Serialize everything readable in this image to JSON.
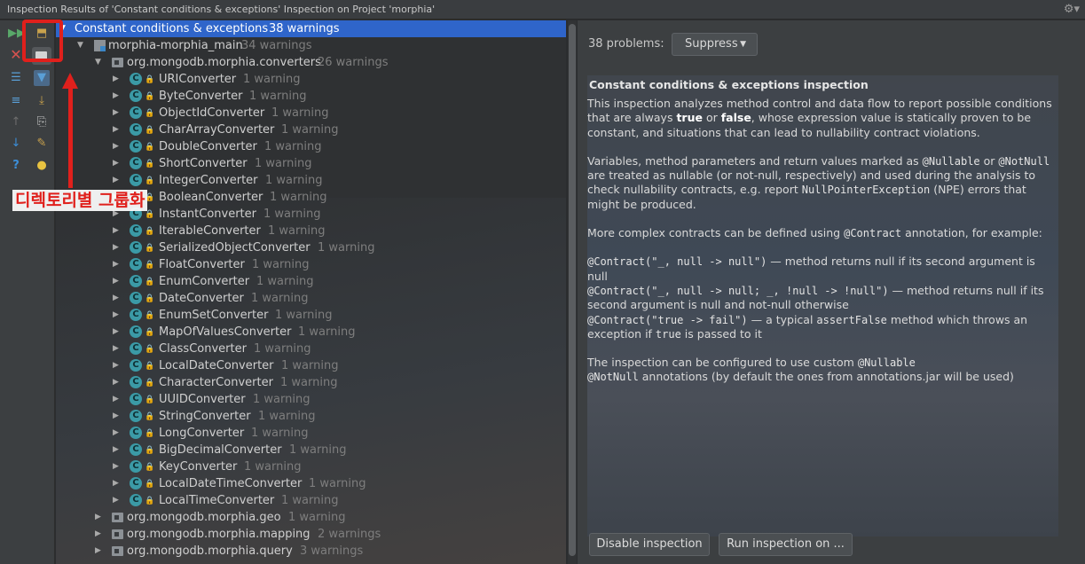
{
  "window": {
    "title": "Inspection Results of 'Constant conditions & exceptions' Inspection on Project 'morphia'"
  },
  "toolbar": {
    "icons": [
      "rerun-icon",
      "export-icon",
      "close-icon",
      "group-by-directory-icon",
      "expand-all-icon",
      "filter-icon",
      "collapse-all-icon",
      "import-icon",
      "previous-icon",
      "apply-fix-icon",
      "next-icon",
      "settings-icon",
      "help-icon",
      "lightbulb-icon"
    ],
    "accent": "#e0201c"
  },
  "annotation": {
    "label": "디렉토리별 그룹화"
  },
  "tree": {
    "root": {
      "name": "Constant conditions & exceptions",
      "count": "38 warnings"
    },
    "module": {
      "name": "morphia-morphia_main",
      "count": "34 warnings"
    },
    "package": {
      "name": "org.mongodb.morphia.converters",
      "count": "26 warnings"
    },
    "classes": [
      {
        "name": "URIConverter",
        "count": "1 warning"
      },
      {
        "name": "ByteConverter",
        "count": "1 warning"
      },
      {
        "name": "ObjectIdConverter",
        "count": "1 warning"
      },
      {
        "name": "CharArrayConverter",
        "count": "1 warning"
      },
      {
        "name": "DoubleConverter",
        "count": "1 warning"
      },
      {
        "name": "ShortConverter",
        "count": "1 warning"
      },
      {
        "name": "IntegerConverter",
        "count": "1 warning"
      },
      {
        "name": "BooleanConverter",
        "count": "1 warning"
      },
      {
        "name": "InstantConverter",
        "count": "1 warning"
      },
      {
        "name": "IterableConverter",
        "count": "1 warning"
      },
      {
        "name": "SerializedObjectConverter",
        "count": "1 warning"
      },
      {
        "name": "FloatConverter",
        "count": "1 warning"
      },
      {
        "name": "EnumConverter",
        "count": "1 warning"
      },
      {
        "name": "DateConverter",
        "count": "1 warning"
      },
      {
        "name": "EnumSetConverter",
        "count": "1 warning"
      },
      {
        "name": "MapOfValuesConverter",
        "count": "1 warning"
      },
      {
        "name": "ClassConverter",
        "count": "1 warning"
      },
      {
        "name": "LocalDateConverter",
        "count": "1 warning"
      },
      {
        "name": "CharacterConverter",
        "count": "1 warning"
      },
      {
        "name": "UUIDConverter",
        "count": "1 warning"
      },
      {
        "name": "StringConverter",
        "count": "1 warning"
      },
      {
        "name": "LongConverter",
        "count": "1 warning"
      },
      {
        "name": "BigDecimalConverter",
        "count": "1 warning"
      },
      {
        "name": "KeyConverter",
        "count": "1 warning"
      },
      {
        "name": "LocalDateTimeConverter",
        "count": "1 warning"
      },
      {
        "name": "LocalTimeConverter",
        "count": "1 warning"
      }
    ],
    "packages": [
      {
        "name": "org.mongodb.morphia.geo",
        "count": "1 warning"
      },
      {
        "name": "org.mongodb.morphia.mapping",
        "count": "2 warnings"
      },
      {
        "name": "org.mongodb.morphia.query",
        "count": "3 warnings"
      }
    ]
  },
  "details": {
    "problems_label": "38 problems:",
    "suppress_label": "Suppress",
    "title": "Constant conditions & exceptions inspection",
    "p1": {
      "a": "This inspection analyzes method control and data flow to report possible conditions that are always ",
      "b": "true",
      "c": " or ",
      "d": "false",
      "e": ", whose expression value is statically proven to be constant, and situations that can lead to nullability contract violations."
    },
    "p2": {
      "a": "Variables, method parameters and return values marked as ",
      "b": "@Nullable",
      "c": " or ",
      "d": "@NotNull",
      "e": " are treated as nullable (or not-null, respectively) and used during the analysis to check nullability contracts, e.g. report ",
      "f": "NullPointerException",
      "g": " (NPE) errors that might be produced."
    },
    "p3": {
      "a": "More complex contracts can be defined using ",
      "b": "@Contract",
      "c": " annotation, for example:"
    },
    "p4": {
      "c1": "@Contract(\"_, null -> null\")",
      "t1": " — method returns null if its second argument is null",
      "c2": "@Contract(\"_, null -> null; _, !null -> !null\")",
      "t2": " — method returns null if its second argument is null and not-null otherwise",
      "c3": "@Contract(\"true -> fail\")",
      "t3": " — a typical ",
      "c4": "assertFalse",
      "t4": " method which throws an exception if ",
      "c5": "true",
      "t5": " is passed to it"
    },
    "p5": {
      "a": "The inspection can be configured to use custom ",
      "b": "@Nullable",
      "c": "@NotNull",
      "d": " annotations (by default the ones from annotations.jar will be used)"
    },
    "disable_label": "Disable inspection",
    "run_label": "Run inspection on ..."
  }
}
